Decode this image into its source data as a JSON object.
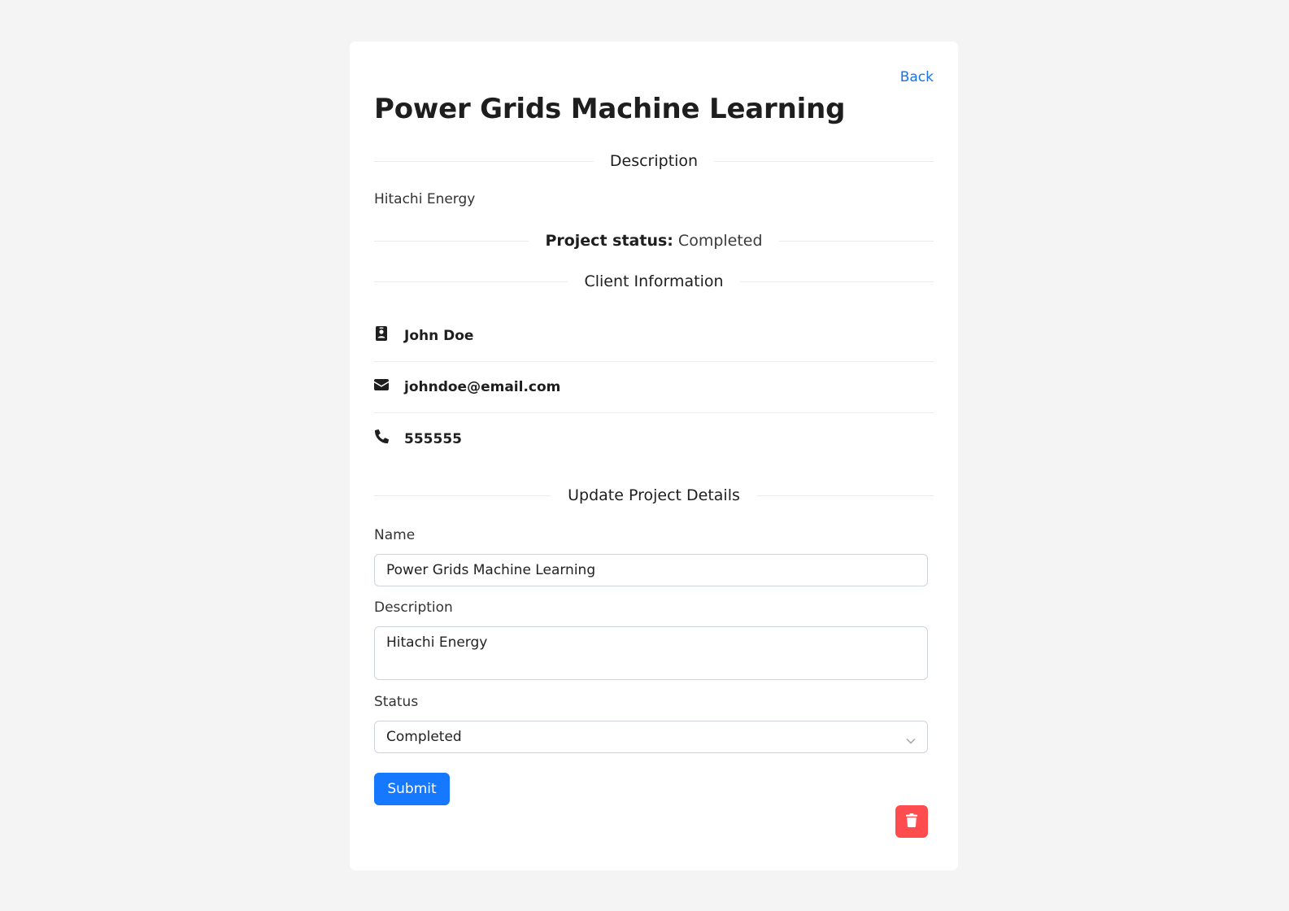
{
  "header": {
    "back_label": "Back",
    "title": "Power Grids Machine Learning"
  },
  "description_section": {
    "heading": "Description",
    "text": "Hitachi Energy"
  },
  "status_section": {
    "label": "Project status:",
    "value": "Completed"
  },
  "client_section": {
    "heading": "Client Information",
    "items": [
      {
        "icon": "contact-card-icon",
        "value": "John Doe"
      },
      {
        "icon": "envelope-icon",
        "value": "johndoe@email.com"
      },
      {
        "icon": "phone-icon",
        "value": "555555"
      }
    ]
  },
  "update_section": {
    "heading": "Update Project Details",
    "name_label": "Name",
    "name_value": "Power Grids Machine Learning",
    "description_label": "Description",
    "description_value": "Hitachi Energy",
    "status_label": "Status",
    "status_value": "Completed",
    "submit_label": "Submit",
    "delete_icon": "trash-icon"
  },
  "colors": {
    "primary": "#1677ff",
    "danger": "#ff4d4f",
    "link": "#1a73e8",
    "background": "#f4f4f4"
  }
}
